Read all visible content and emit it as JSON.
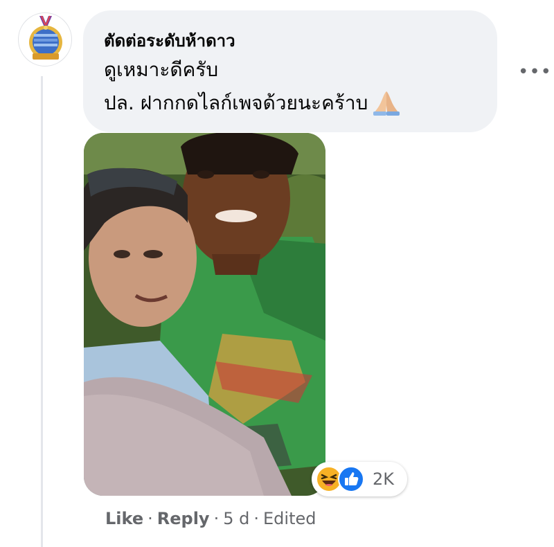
{
  "comment": {
    "author": "ตัดต่อระดับห้าดาว",
    "line1": "ดูเหมาะดีครับ",
    "line2": "ปล. ฝากกดไลก์เพจด้วยนะคร้าบ",
    "emoji": "folded-hands-emoji"
  },
  "more_label": "•••",
  "reactions": {
    "count": "2K",
    "icons": [
      "haha-reaction-icon",
      "like-reaction-icon"
    ]
  },
  "actions": {
    "like": "Like",
    "reply": "Reply",
    "separator": "·",
    "time": "5 d",
    "edited": "Edited"
  },
  "colors": {
    "bubble": "#f0f2f5",
    "meta_text": "#65676b",
    "like_blue": "#1877f2",
    "haha_yellow": "#f7b125"
  }
}
